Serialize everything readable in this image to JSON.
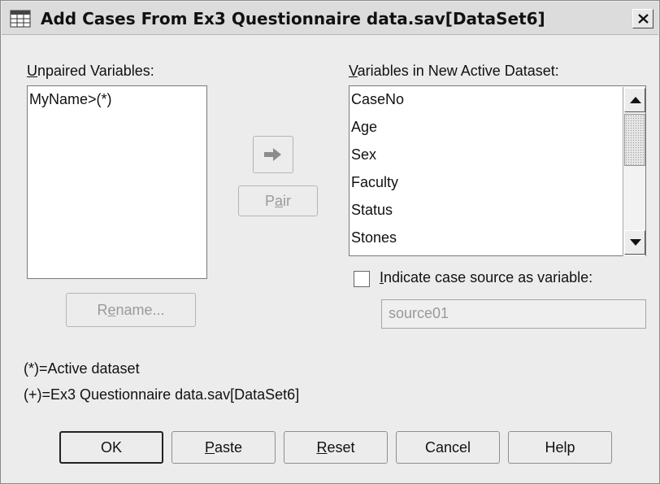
{
  "window": {
    "title": "Add Cases From Ex3 Questionnaire data.sav[DataSet6]",
    "close_icon": "close-icon"
  },
  "unpaired": {
    "label_accel": "U",
    "label_rest": "npaired Variables:",
    "items": [
      "MyName>(*)"
    ]
  },
  "pair_arrow_icon": "right-arrow-icon",
  "pair_button": {
    "pre": "P",
    "accel": "a",
    "post": "ir"
  },
  "rename_button": {
    "pre": "R",
    "accel": "e",
    "post": "name..."
  },
  "new_dataset": {
    "label_accel": "V",
    "label_rest": "ariables in New Active Dataset:",
    "items": [
      "CaseNo",
      "Age",
      "Sex",
      "Faculty",
      "Status",
      "Stones"
    ]
  },
  "indicate": {
    "label_accel": "I",
    "label_rest": "ndicate case source as variable:",
    "checked": false,
    "field_value": "source01"
  },
  "legend": {
    "active": "(*)=Active dataset",
    "other": "(+)=Ex3 Questionnaire data.sav[DataSet6]"
  },
  "buttons": {
    "ok": "OK",
    "paste_accel": "P",
    "paste_rest": "aste",
    "reset_accel": "R",
    "reset_rest": "eset",
    "cancel": "Cancel",
    "help": "Help"
  }
}
